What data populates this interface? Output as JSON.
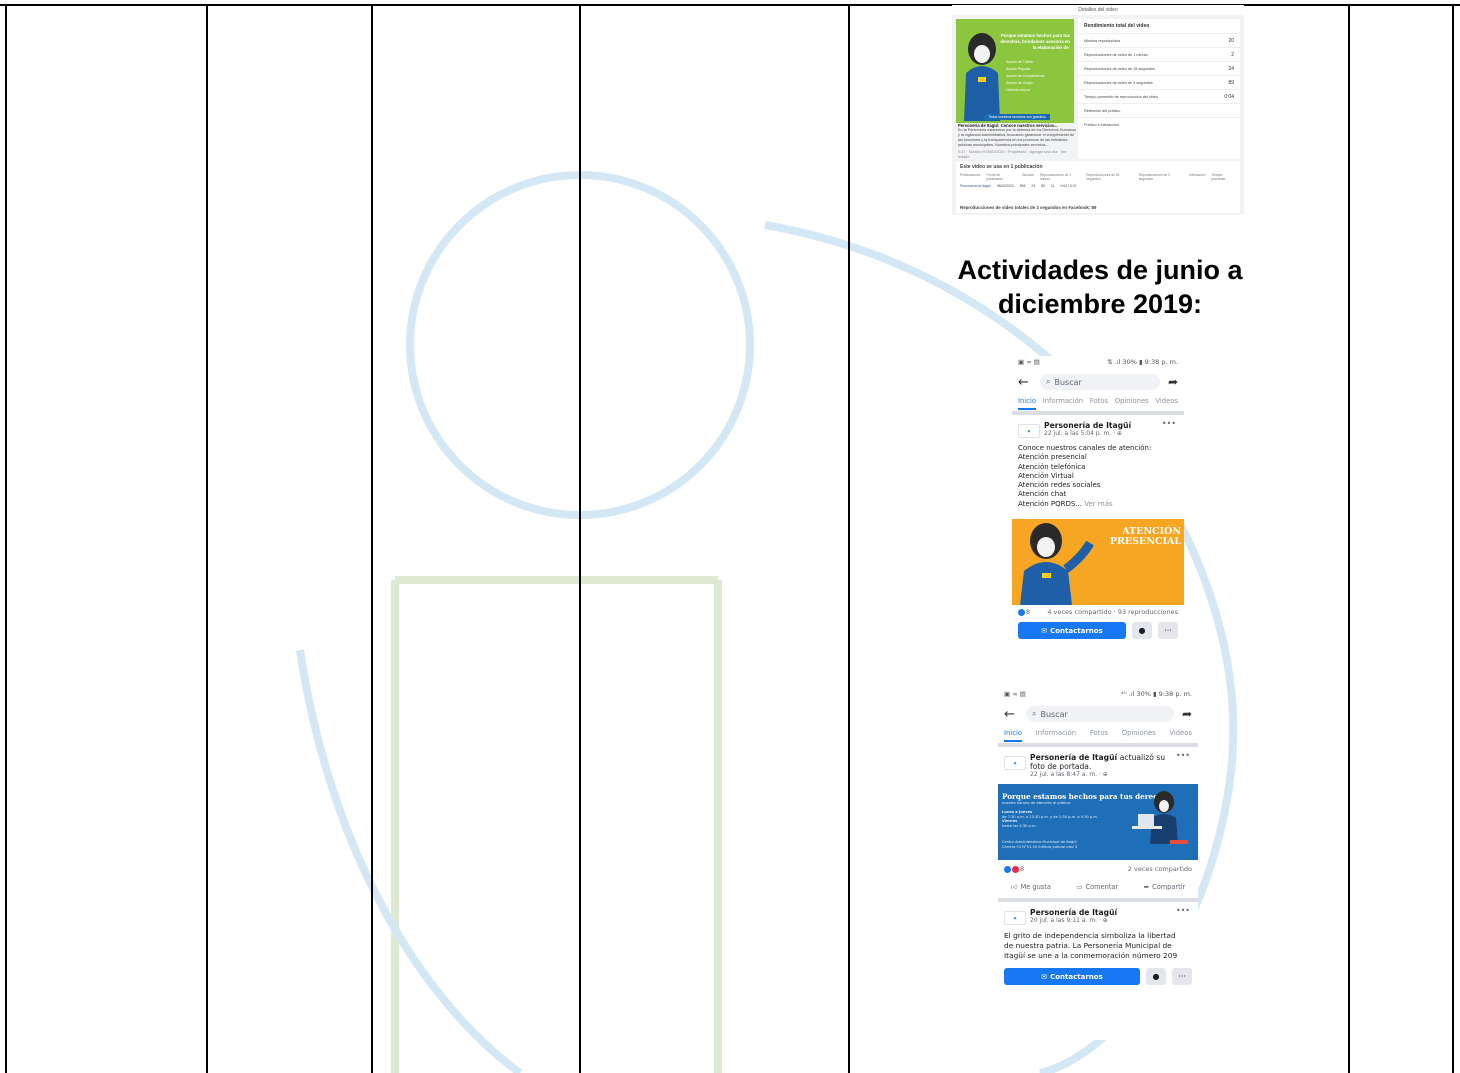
{
  "colors": {
    "facebook_blue": "#1877f2",
    "promo_green": "#8cc63f",
    "banner_orange": "#f6a623",
    "banner_blue": "#1f6fb8",
    "watermark": "#c8dff0"
  },
  "analytics": {
    "window_title": "Detalles del video",
    "promo_headline": "Porque estamos hechos para tus derechos, brindamos asesoría en la elaboración de:",
    "promo_items": [
      "Acción de Tutela",
      "Acción Popular",
      "Acción de Cumplimiento",
      "Acción de Grupo",
      "Habeas corpus"
    ],
    "promo_button": "Todos nuestros servicios son gratuitos",
    "post_title": "Personería de Itagüí: Conoce nuestros servicios...",
    "post_desc": "En la Personería estaremos por la defensa de los Derechos Humanos y la vigilancia administrativa, buscando garantizar el cumplimiento de las funciones y la transparencia en los procesos de las entidades públicas municipales. Nuestros principales servicios...",
    "post_meta": "0:37 · Subido el 06/02/2020 · Propietario · Agregar una cita · Ver estado",
    "performance_title": "Rendimiento total del video",
    "performance_rows": [
      {
        "label": "Minutos reproducidos",
        "value": "20"
      },
      {
        "label": "Reproducciones de video de 1 minuto",
        "value": "2"
      },
      {
        "label": "Reproducciones de video de 15 segundos",
        "value": "24"
      },
      {
        "label": "Reproducciones de video de 3 segundos",
        "value": "89"
      },
      {
        "label": "Tiempo promedio de reproducción del video",
        "value": "0:04"
      },
      {
        "label": "Retención del público",
        "value": ""
      },
      {
        "label": "Público e interacción",
        "value": ""
      }
    ],
    "usage_title": "Este video se usa en 1 publicación",
    "usage_columns": [
      "Publicaciones",
      "Fecha de publicación",
      "Alcance",
      "Reproducciones de 1 minuto",
      "Reproducciones de 15 segundos",
      "Reproducciones de 3 segundos",
      "Interacción",
      "Tiempo promedio"
    ],
    "usage_row": [
      "Personería de Itagüí",
      "06/02/2020",
      "894",
      "24",
      "89",
      "11",
      "0:04 / 0:37"
    ],
    "usage_footer": "Reproducciones de video totales de 3 segundos en Facebook: 89"
  },
  "heading": {
    "line1": "Actividades de junio a",
    "line2": "diciembre 2019:"
  },
  "phone1": {
    "status_right": "⇅ .ıl 30% ▮ 9:38 p. m.",
    "search_placeholder": "Buscar",
    "tabs": [
      "Inicio",
      "Información",
      "Fotos",
      "Opiniones",
      "Videos"
    ],
    "page_name": "Personería de Itagüí",
    "post_date": "22 jul. a las 5:04 p. m. · ⊕",
    "text_lines": [
      "Conoce nuestros canales de atención:",
      "Atención presencial",
      "Atención telefónica",
      "Atención Virtual",
      "Atención redes sociales",
      "Atención chat",
      "Atención PQRDS..."
    ],
    "see_more": "Ver más",
    "banner_text": [
      "ATENCIÓN",
      "PRESENCIAL"
    ],
    "reactions": "8",
    "shares": "4 veces compartido · 93 reproducciones",
    "contact_button": "Contactarnos"
  },
  "phone2": {
    "status_right": "⁴ᴳ .ıl 30% ▮ 9:38 p. m.",
    "search_placeholder": "Buscar",
    "tabs": [
      "Inicio",
      "Información",
      "Fotos",
      "Opiniones",
      "Videos"
    ],
    "page_name": "Personería de Itagüí",
    "post1_action": "actualizó su foto de portada.",
    "post1_date": "22 jul. a las 8:47 a. m. · ⊕",
    "banner_title": "Porque estamos hechos para tus derechos",
    "banner_subtitle": "nuestro horario de atención al público",
    "banner_hours": [
      "Lunes a Jueves",
      "de 7:30 a.m. a 12:30 p.m. y de 1:30 p.m. a 5:30 p.m.",
      "Viernes",
      "hasta las 4:30 p.m."
    ],
    "banner_address": [
      "Centro Administrativo Municipal de Itagüí",
      "Carrera 51 N°51-55 Edificio Judicial piso 3"
    ],
    "reactions": "8",
    "shares": "2 veces compartido",
    "actions": [
      "Me gusta",
      "Comentar",
      "Compartir"
    ],
    "post2_date": "20 jul. a las 9:11 a. m. · ⊕",
    "post2_text": [
      "El grito de independencia simboliza la libertad",
      "de nuestra patria. La Personería Municipal de",
      "Itagüí se une a la conmemoración número 209"
    ],
    "contact_button": "Contactarnos"
  }
}
